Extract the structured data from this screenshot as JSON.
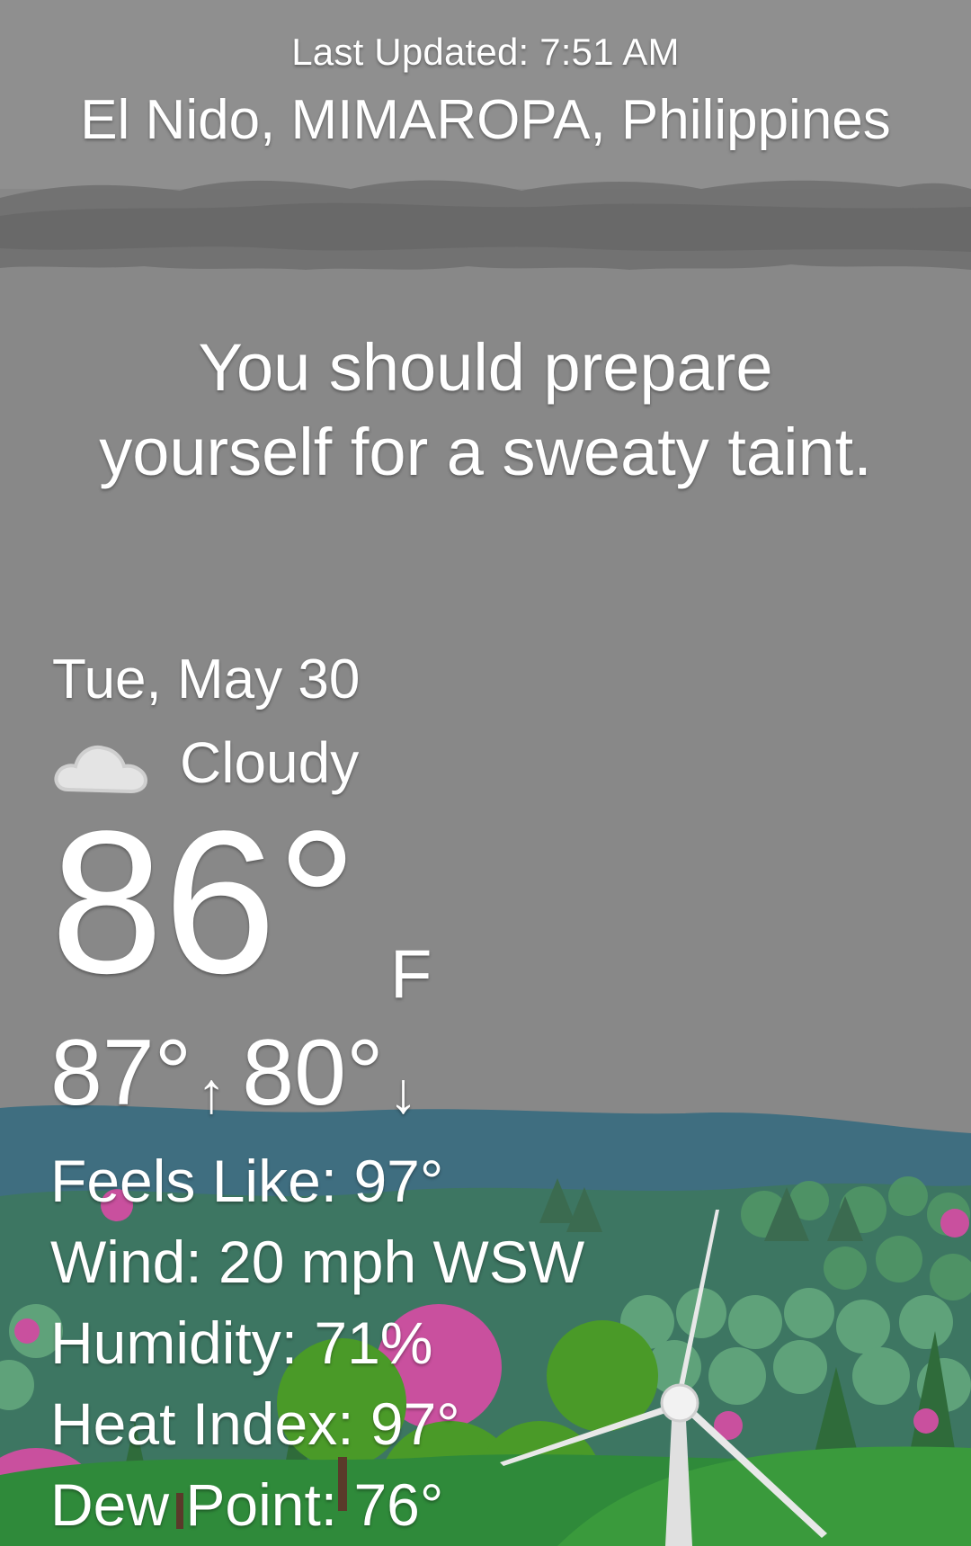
{
  "header": {
    "last_updated": "Last Updated: 7:51 AM",
    "location": "El Nido, MIMAROPA, Philippines"
  },
  "message": {
    "line1": "You should prepare",
    "line2": "yourself for a sweaty taint."
  },
  "current": {
    "date": "Tue, May 30",
    "condition": "Cloudy",
    "condition_icon": "cloud-icon",
    "temperature": "86°",
    "unit": "F",
    "high": "87°",
    "high_arrow": "↑",
    "low": "80°",
    "low_arrow": "↓"
  },
  "details": {
    "feels_like": "Feels Like:  97°",
    "wind": "Wind:  20 mph WSW",
    "humidity": "Humidity:  71%",
    "heat_index": "Heat Index:  97°",
    "dew_point": "Dew Point:  76°"
  },
  "colors": {
    "sky": "#888888",
    "cloud_band": "#707070",
    "mountains": "#3f6e80",
    "hills": "#3e7460",
    "grass": "#2f8a3a",
    "pink_tree": "#c9509e",
    "text": "#ffffff"
  }
}
